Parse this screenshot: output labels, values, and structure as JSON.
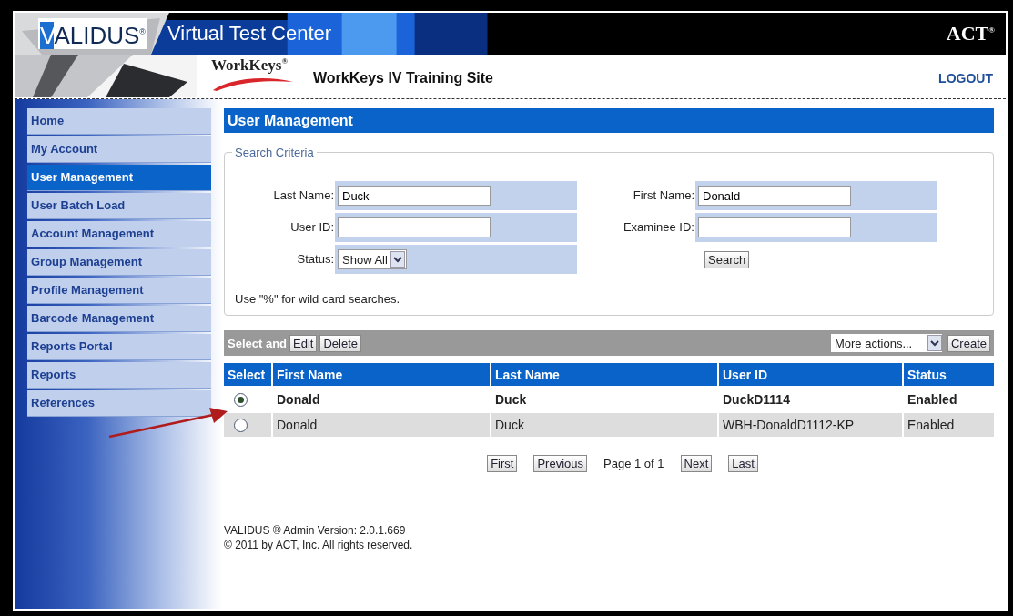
{
  "header": {
    "brand": "VALIDUS$^{®}$",
    "product": "Virtual Test Center",
    "company": "ACT$^{®}$",
    "site_logo": "WorkKeys$^{®}$",
    "site_title": "WorkKeys IV Training Site",
    "logout": "LOGOUT"
  },
  "sidebar": {
    "items": [
      {
        "label": "Home",
        "selected": false
      },
      {
        "label": "My Account",
        "selected": false
      },
      {
        "label": "User Management",
        "selected": true
      },
      {
        "label": "User Batch Load",
        "selected": false
      },
      {
        "label": "Account Management",
        "selected": false
      },
      {
        "label": "Group Management",
        "selected": false
      },
      {
        "label": "Profile Management",
        "selected": false
      },
      {
        "label": "Barcode Management",
        "selected": false
      },
      {
        "label": "Reports Portal",
        "selected": false
      },
      {
        "label": "Reports",
        "selected": false
      },
      {
        "label": "References",
        "selected": false
      }
    ]
  },
  "page_title": "User Management",
  "search": {
    "legend": "Search Criteria",
    "left_fields": [
      {
        "kind": "text",
        "label": "Last Name:",
        "value": "Duck"
      },
      {
        "kind": "text",
        "label": "User ID:"
      },
      {
        "kind": "select",
        "label": "Status:",
        "value": "Show All"
      }
    ],
    "right_fields": [
      {
        "kind": "text",
        "label": "First Name:",
        "value": "Donald"
      },
      {
        "kind": "text",
        "label": "Examinee ID:"
      }
    ],
    "button": "Search",
    "hint": "Use \"%\" for wild card searches."
  },
  "toolbar": {
    "label": "Select and",
    "buttons": [
      "Edit",
      "Delete"
    ],
    "actions": "More actions...",
    "create": "Create"
  },
  "table": {
    "columns": [
      "Select",
      "First Name",
      "Last Name",
      "User ID",
      "Status"
    ],
    "rows": [
      {
        "selected": true,
        "cells": [
          "",
          "Donald",
          "Duck",
          "DuckD1114",
          "Enabled"
        ]
      },
      {
        "selected": false,
        "cells": [
          "",
          "Donald",
          "Duck",
          "WBH-DonaldD1112-KP",
          "Enabled"
        ]
      }
    ]
  },
  "pagination": {
    "first": "First",
    "previous": "Previous",
    "page": "Page 1 of 1",
    "next": "Next",
    "last": "Last"
  },
  "footer": [
    "VALIDUS ® Admin Version: 2.0.1.669",
    "© 2011 by ACT, Inc. All rights reserved."
  ]
}
